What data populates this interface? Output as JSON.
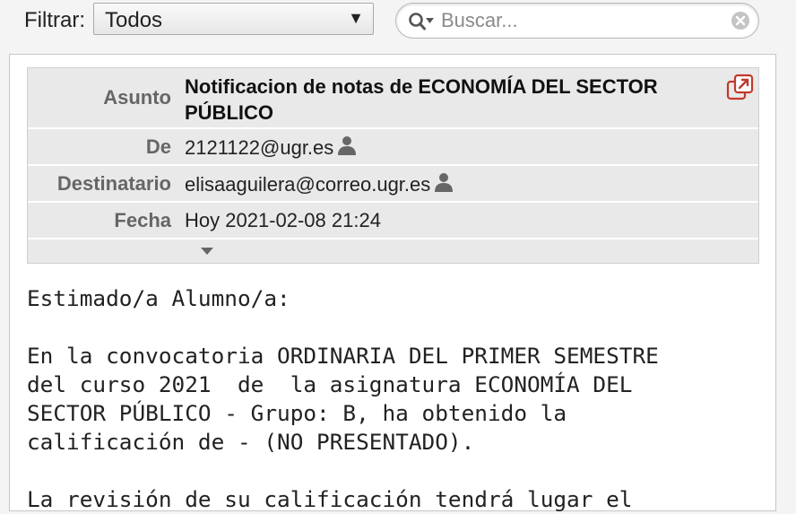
{
  "toolbar": {
    "filter_label": "Filtrar:",
    "filter_value": "Todos",
    "search_placeholder": "Buscar...",
    "search_value": ""
  },
  "headers": {
    "subject_label": "Asunto",
    "subject_value": "Notificacion de notas de ECONOMÍA DEL SECTOR PÚBLICO",
    "from_label": "De",
    "from_value": "2121122@ugr.es",
    "to_label": "Destinatario",
    "to_value": "elisaaguilera@correo.ugr.es",
    "date_label": "Fecha",
    "date_value": "Hoy 2021-02-08 21:24"
  },
  "body": {
    "text": "Estimado/a Alumno/a:\n\nEn la convocatoria ORDINARIA DEL PRIMER SEMESTRE\ndel curso 2021  de  la asignatura ECONOMÍA DEL\nSECTOR PÚBLICO - Grupo: B, ha obtenido la\ncalificación de - (NO PRESENTADO).\n\nLa revisión de su calificación tendrá lugar el"
  },
  "icons": {
    "search": "search-options-icon",
    "reset": "reset-search-icon",
    "person": "person-icon",
    "expand": "expand-headers-icon",
    "popout": "open-in-new-window-icon"
  },
  "colors": {
    "popout_accent": "#c0392b",
    "header_background": "#e9e9e9",
    "label_text": "#666666"
  }
}
